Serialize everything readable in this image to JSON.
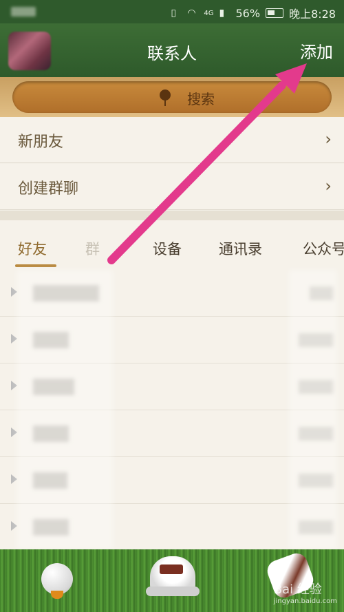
{
  "status_bar": {
    "signal_label": "4G",
    "battery_percent": "56%",
    "time": "晚上8:28"
  },
  "header": {
    "title": "联系人",
    "add_label": "添加"
  },
  "search": {
    "label": "搜索"
  },
  "menu": [
    {
      "label": "新朋友"
    },
    {
      "label": "创建群聊"
    }
  ],
  "tabs": [
    {
      "label": "好友",
      "active": true
    },
    {
      "label": "群",
      "active": false
    },
    {
      "label": "设备",
      "active": false
    },
    {
      "label": "通讯录",
      "active": false
    },
    {
      "label": "公众号",
      "active": false
    }
  ],
  "colors": {
    "header_green": "#2f5a2c",
    "arrow_pink": "#e33a8c",
    "tab_active": "#8f6a2e"
  },
  "bottom_nav": [
    {
      "name": "golf-ball-icon"
    },
    {
      "name": "golf-cap-icon"
    },
    {
      "name": "golf-shoe-icon"
    }
  ],
  "watermark": {
    "text": "Bai 经验",
    "subtext": "jingyan.baidu.com"
  }
}
